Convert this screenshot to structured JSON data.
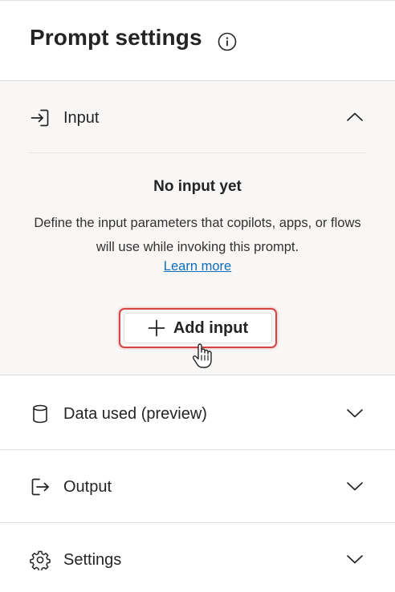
{
  "header": {
    "title": "Prompt settings",
    "info_icon": "info-icon"
  },
  "sections": {
    "input": {
      "label": "Input",
      "icon": "sign-in-icon",
      "expanded": true,
      "empty_title": "No input yet",
      "empty_description": "Define the input parameters that copilots, apps, or flows will use while invoking this prompt.",
      "learn_more": "Learn more",
      "add_button": "Add input"
    },
    "data_used": {
      "label": "Data used (preview)",
      "icon": "database-icon",
      "expanded": false
    },
    "output": {
      "label": "Output",
      "icon": "sign-out-icon",
      "expanded": false
    },
    "settings": {
      "label": "Settings",
      "icon": "gear-icon",
      "expanded": false
    }
  },
  "colors": {
    "accent_link": "#0f6cbd",
    "highlight": "#d64545",
    "section_bg": "#f8f7f6",
    "text": "#242424"
  }
}
